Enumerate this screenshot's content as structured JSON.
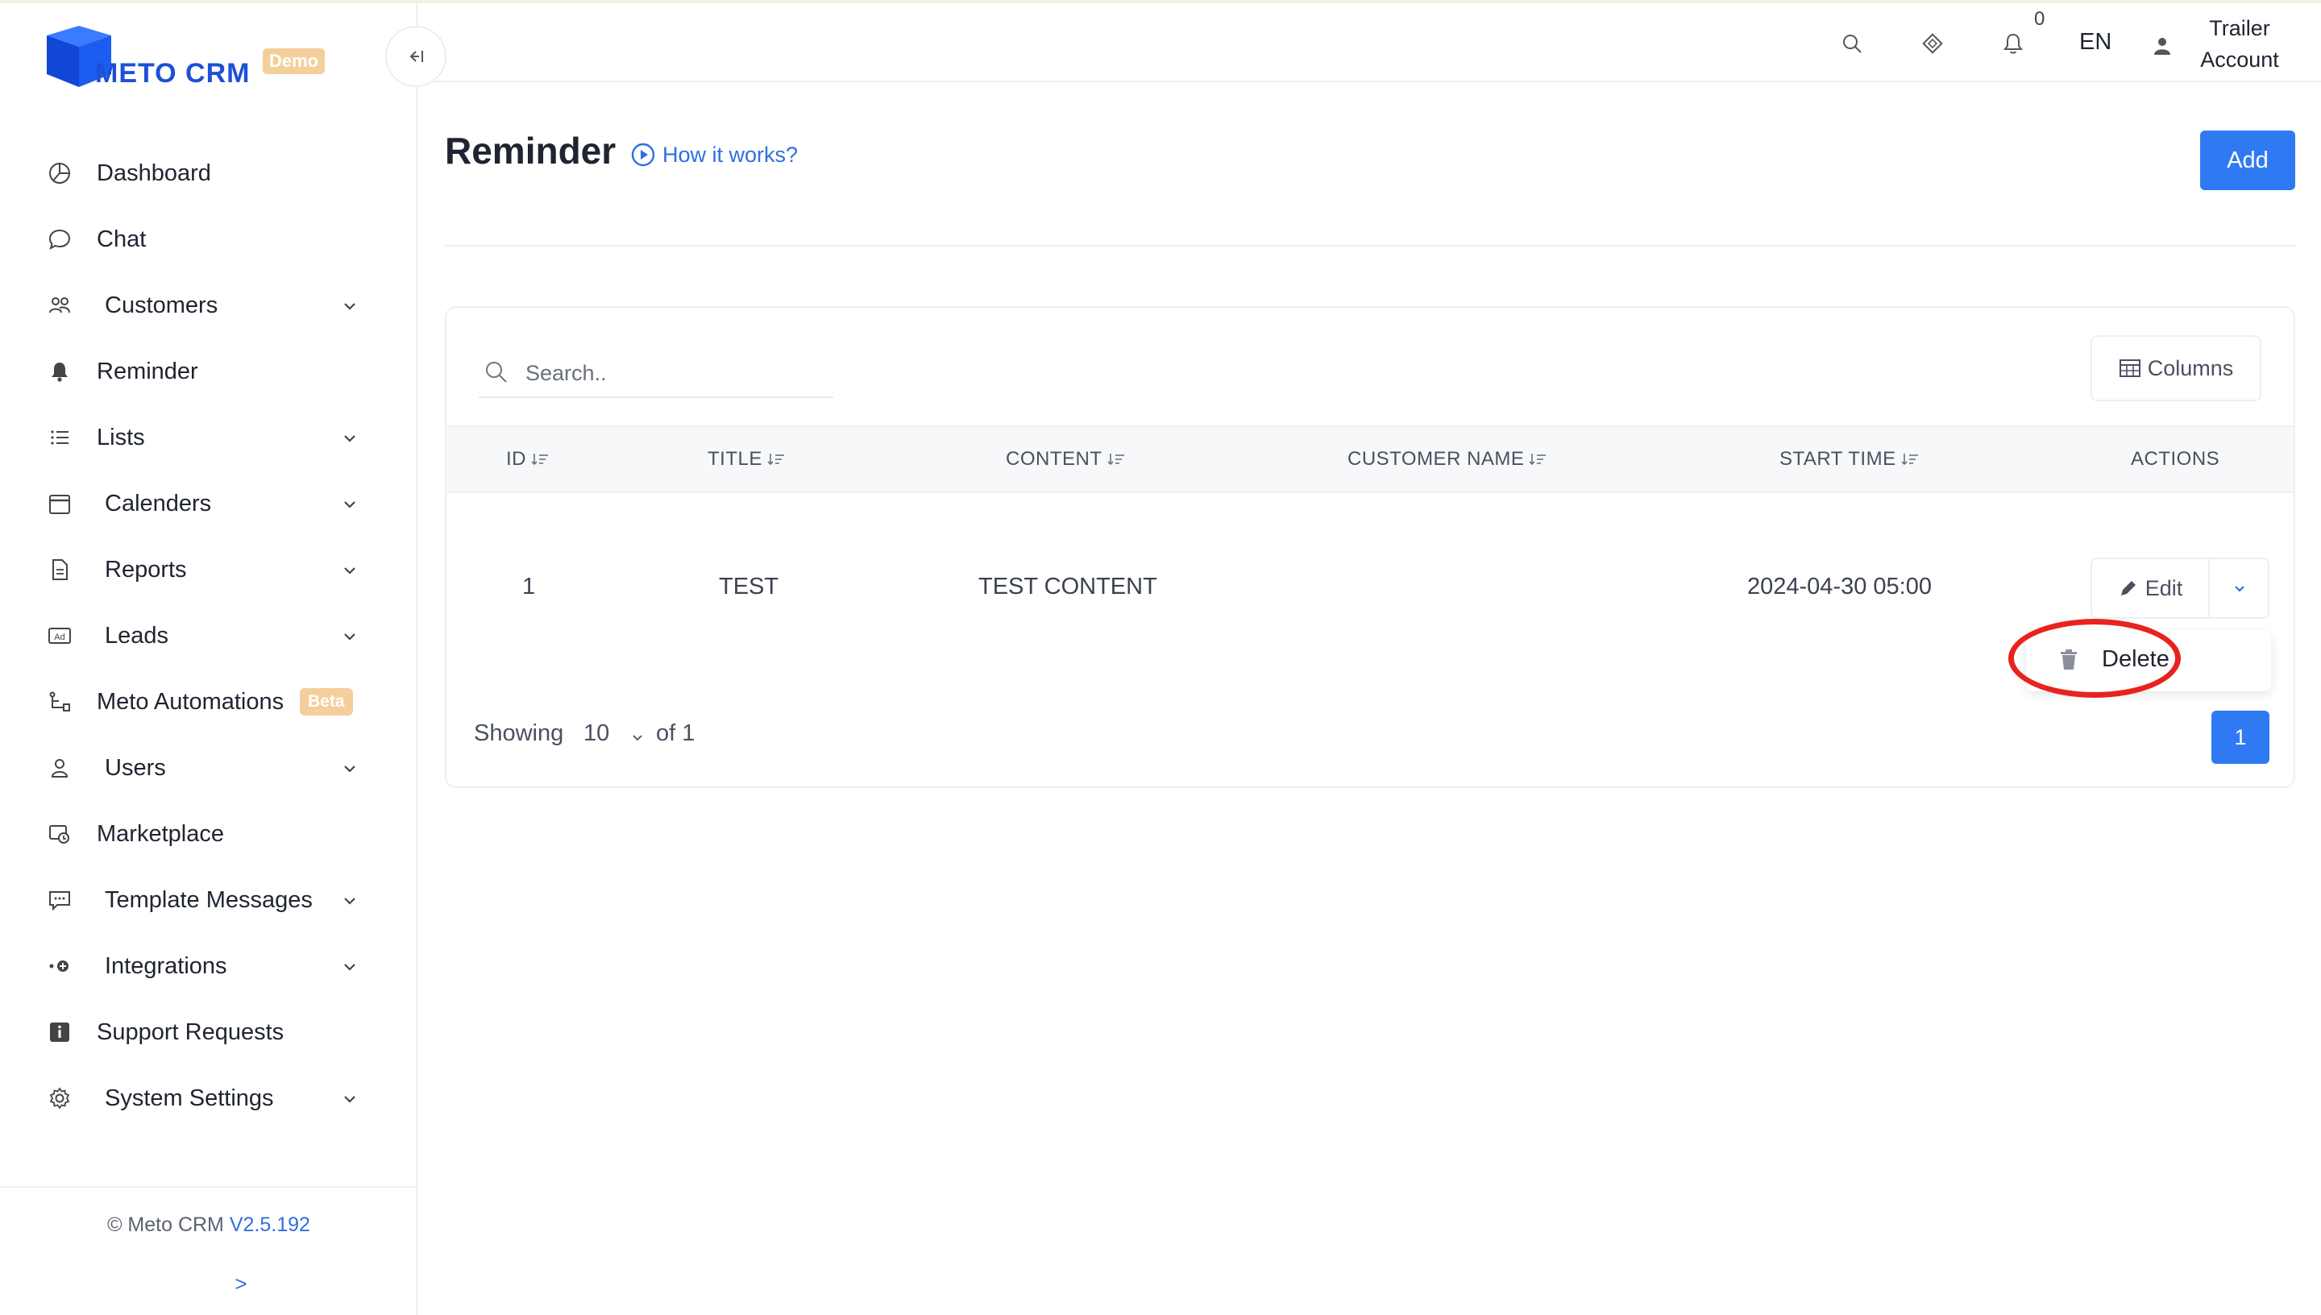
{
  "app": {
    "brand": "METO CRM",
    "badge": "Demo"
  },
  "sidebar": {
    "items": [
      {
        "label": "Dashboard",
        "icon": "pie-chart-icon",
        "expandable": false
      },
      {
        "label": "Chat",
        "icon": "chat-bubble-icon",
        "expandable": false
      },
      {
        "label": "Customers",
        "icon": "users-group-icon",
        "expandable": true
      },
      {
        "label": "Reminder",
        "icon": "bell-icon",
        "expandable": false
      },
      {
        "label": "Lists",
        "icon": "list-icon",
        "expandable": true
      },
      {
        "label": "Calenders",
        "icon": "calendar-icon",
        "expandable": true
      },
      {
        "label": "Reports",
        "icon": "document-icon",
        "expandable": true
      },
      {
        "label": "Leads",
        "icon": "ad-icon",
        "expandable": true
      },
      {
        "label": "Meto Automations",
        "icon": "automation-icon",
        "expandable": false,
        "badge": "Beta"
      },
      {
        "label": "Users",
        "icon": "user-icon",
        "expandable": true
      },
      {
        "label": "Marketplace",
        "icon": "marketplace-icon",
        "expandable": false
      },
      {
        "label": "Template Messages",
        "icon": "message-template-icon",
        "expandable": true
      },
      {
        "label": "Integrations",
        "icon": "integrations-icon",
        "expandable": true
      },
      {
        "label": "Support Requests",
        "icon": "info-icon",
        "expandable": false
      },
      {
        "label": "System Settings",
        "icon": "gear-icon",
        "expandable": true
      }
    ],
    "footer": {
      "copyright": "© Meto CRM",
      "version": "V2.5.192",
      "arrow": ">"
    }
  },
  "header": {
    "notification_count": "0",
    "language": "EN",
    "account_line1": "Trailer",
    "account_line2": "Account"
  },
  "page": {
    "title": "Reminder",
    "help_link": "How it works?",
    "add_label": "Add"
  },
  "table": {
    "search_placeholder": "Search..",
    "columns_label": "Columns",
    "headers": [
      "ID",
      "TITLE",
      "CONTENT",
      "CUSTOMER NAME",
      "START TIME",
      "ACTIONS"
    ],
    "rows": [
      {
        "id": "1",
        "title": "TEST",
        "content": "TEST CONTENT",
        "customer_name": "",
        "start_time": "2024-04-30 05:00"
      }
    ],
    "edit_label": "Edit",
    "dropdown_delete": "Delete",
    "footer": {
      "showing": "Showing",
      "page_size": "10",
      "of": "of 1",
      "current_page": "1"
    }
  },
  "colors": {
    "primary": "#2f7af2",
    "brand_blue": "#1d4fd8",
    "badge_orange": "#f4cf9b",
    "highlight_red": "#e8231f"
  }
}
